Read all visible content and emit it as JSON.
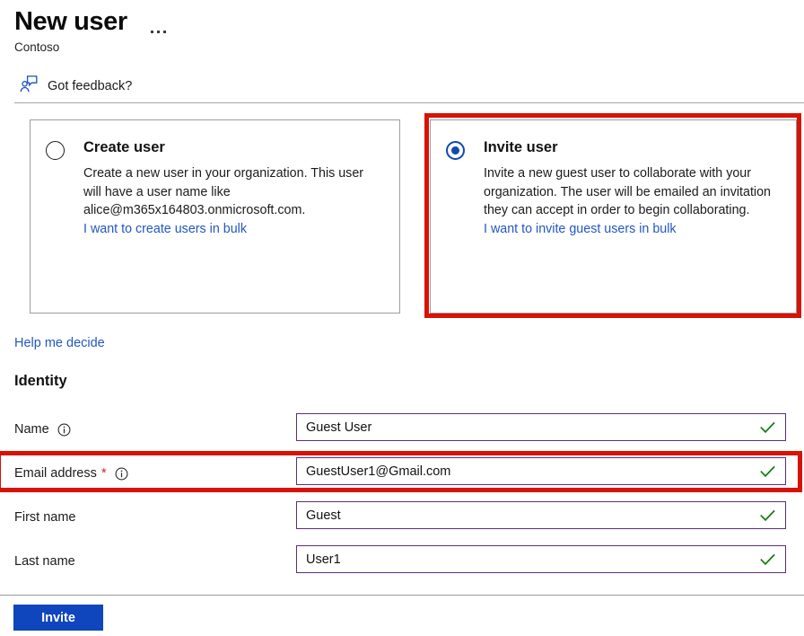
{
  "header": {
    "title": "New user",
    "subtitle": "Contoso",
    "more_menu": "more-options",
    "feedback_label": "Got feedback?"
  },
  "options": {
    "create": {
      "title": "Create user",
      "description": "Create a new user in your organization. This user will have a user name like alice@m365x164803.onmicrosoft.com.",
      "bulk_link": "I want to create users in bulk",
      "selected": false
    },
    "invite": {
      "title": "Invite user",
      "description": "Invite a new guest user to collaborate with your organization. The user will be emailed an invitation they can accept in order to begin collaborating.",
      "bulk_link": "I want to invite guest users in bulk",
      "selected": true
    },
    "help_link": "Help me decide"
  },
  "identity": {
    "section_title": "Identity",
    "fields": [
      {
        "label": "Name",
        "required": false,
        "has_info": true,
        "value": "Guest User",
        "valid": true
      },
      {
        "label": "Email address",
        "required": true,
        "required_marker": "*",
        "has_info": true,
        "value": "GuestUser1@Gmail.com",
        "valid": true
      },
      {
        "label": "First name",
        "required": false,
        "has_info": false,
        "value": "Guest",
        "valid": true
      },
      {
        "label": "Last name",
        "required": false,
        "has_info": false,
        "value": "User1",
        "valid": true
      }
    ]
  },
  "footer": {
    "submit_label": "Invite"
  },
  "highlights": {
    "color": "#d81204",
    "targets": [
      "invite-user-card",
      "email-address-row"
    ]
  },
  "colors": {
    "accent_blue": "#0f45bd",
    "link_blue": "#2257c4",
    "input_border": "#5d2e77",
    "valid_green": "#107c10",
    "required_red": "#c4273c",
    "card_border": "#9e9e9e"
  }
}
